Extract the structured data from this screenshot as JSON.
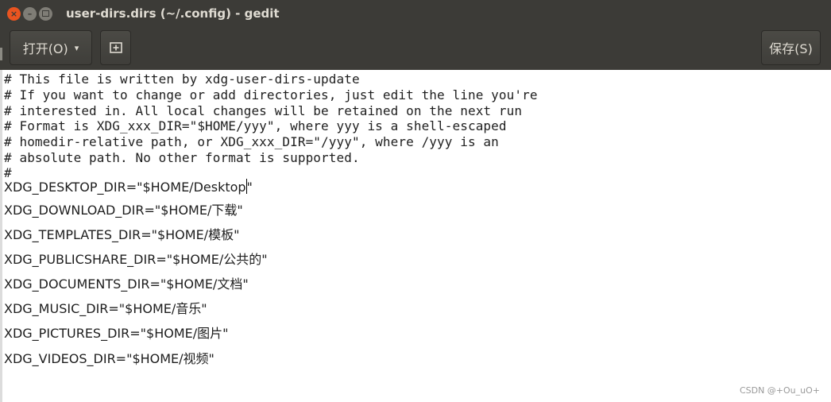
{
  "window": {
    "title": "user-dirs.dirs (~/.config) - gedit",
    "buttons": {
      "close": "×",
      "minimize": "–"
    }
  },
  "toolbar": {
    "open_label": "打开(O)",
    "open_arrow": "▾",
    "new_icon": "⊞",
    "save_label": "保存(S)"
  },
  "editor": {
    "comments": [
      "# This file is written by xdg-user-dirs-update",
      "# If you want to change or add directories, just edit the line you're",
      "# interested in. All local changes will be retained on the next run",
      "# Format is XDG_xxx_DIR=\"$HOME/yyy\", where yyy is a shell-escaped",
      "# homedir-relative path, or XDG_xxx_DIR=\"/yyy\", where /yyy is an",
      "# absolute path. No other format is supported.",
      "#"
    ],
    "desktop_line_before_cursor": "XDG_DESKTOP_DIR=\"$HOME/Desktop",
    "desktop_line_after_cursor": "\"",
    "vars": [
      "XDG_DOWNLOAD_DIR=\"$HOME/下载\"",
      "XDG_TEMPLATES_DIR=\"$HOME/模板\"",
      "XDG_PUBLICSHARE_DIR=\"$HOME/公共的\"",
      "XDG_DOCUMENTS_DIR=\"$HOME/文档\"",
      "XDG_MUSIC_DIR=\"$HOME/音乐\"",
      "XDG_PICTURES_DIR=\"$HOME/图片\"",
      "XDG_VIDEOS_DIR=\"$HOME/视频\""
    ]
  },
  "watermark": "CSDN @+Ou_uO+",
  "colors": {
    "titlebar": "#3c3b37",
    "close_button": "#e95420",
    "title_text": "#dfdbd2",
    "editor_bg": "#ffffff"
  }
}
